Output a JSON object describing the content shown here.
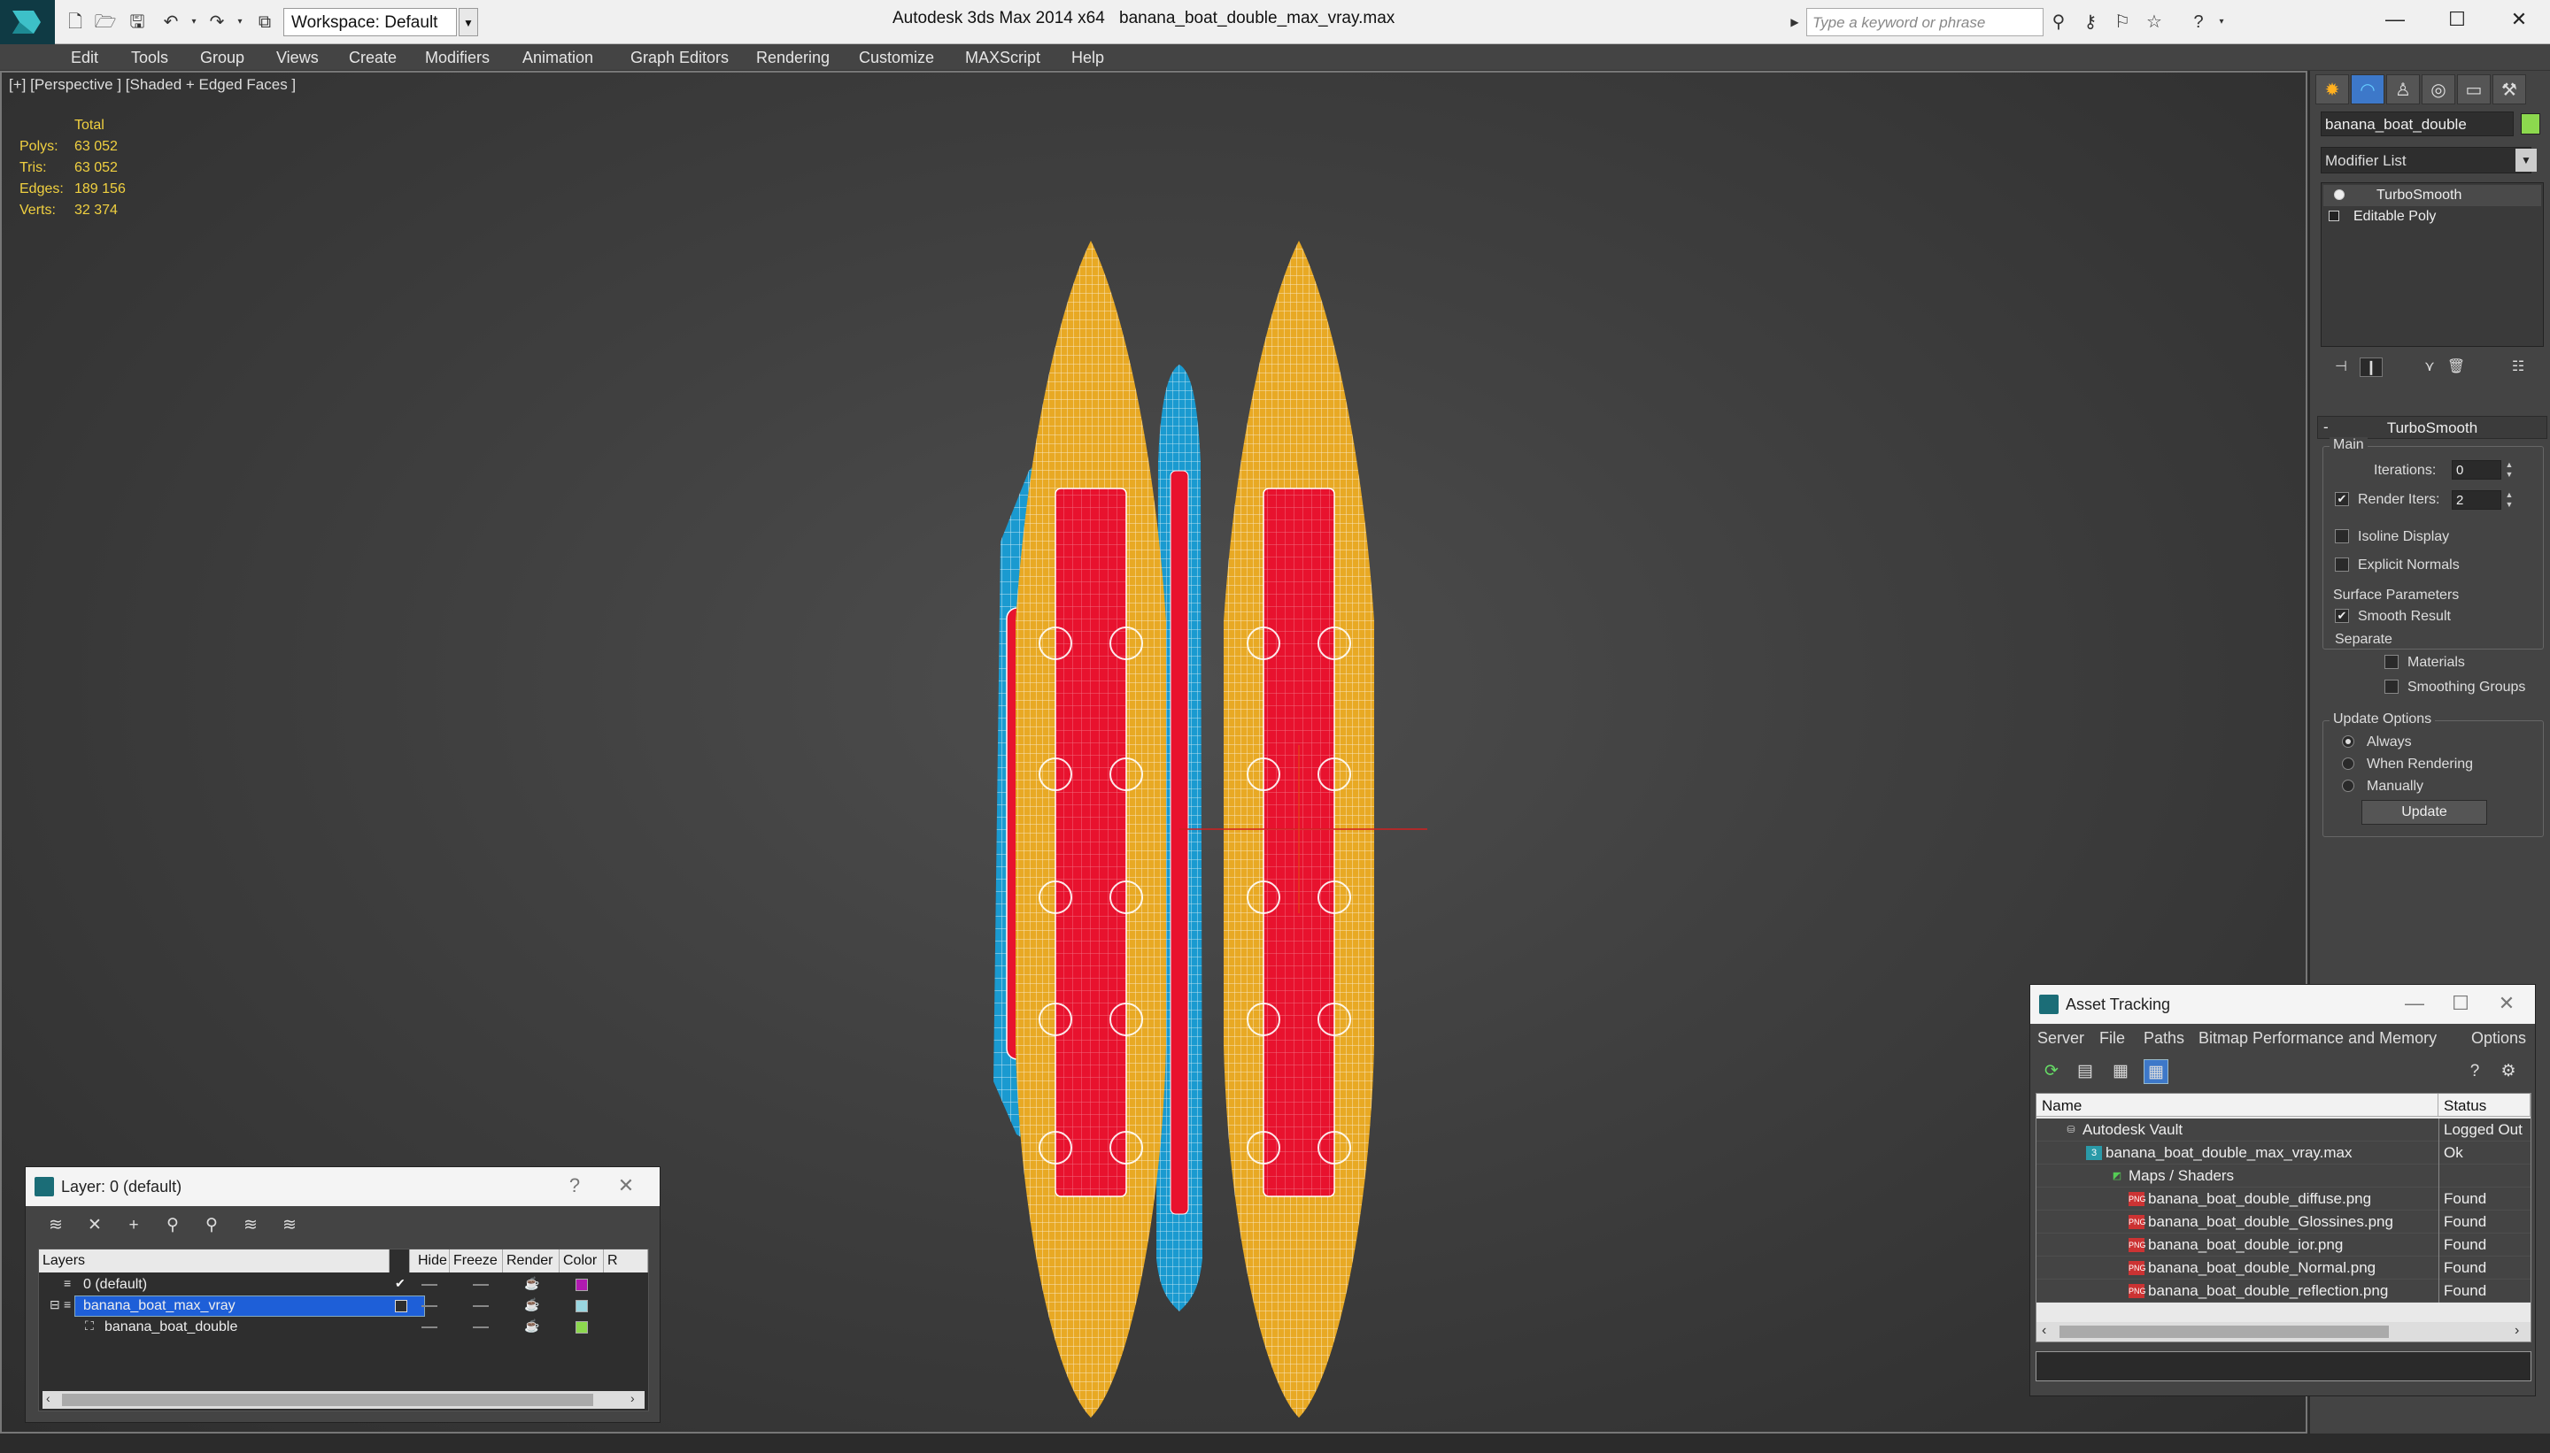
{
  "titlebar": {
    "workspace": "Workspace: Default",
    "app_title": "Autodesk 3ds Max  2014 x64",
    "file_title": "banana_boat_double_max_vray.max",
    "search_placeholder": "Type a keyword or phrase"
  },
  "menu": [
    "Edit",
    "Tools",
    "Group",
    "Views",
    "Create",
    "Modifiers",
    "Animation",
    "Graph Editors",
    "Rendering",
    "Customize",
    "MAXScript",
    "Help"
  ],
  "viewport": {
    "label": "[+] [Perspective ] [Shaded + Edged Faces ]",
    "stats_header": "Total",
    "stats": [
      {
        "label": "Polys:",
        "value": "63 052"
      },
      {
        "label": "Tris:",
        "value": "63 052"
      },
      {
        "label": "Edges:",
        "value": "189 156"
      },
      {
        "label": "Verts:",
        "value": "32 374"
      }
    ]
  },
  "command_panel": {
    "object_name": "banana_boat_double",
    "modifier_list": "Modifier List",
    "stack": [
      "TurboSmooth",
      "Editable Poly"
    ],
    "rollout_title": "TurboSmooth",
    "main_group": "Main",
    "iterations_label": "Iterations:",
    "iterations_value": "0",
    "render_iters_label": "Render Iters:",
    "render_iters_value": "2",
    "isoline_label": "Isoline Display",
    "explicit_normals_label": "Explicit Normals",
    "surface_group": "Surface Parameters",
    "smooth_result_label": "Smooth Result",
    "separate_label": "Separate",
    "materials_label": "Materials",
    "smoothing_groups_label": "Smoothing Groups",
    "update_group": "Update Options",
    "always_label": "Always",
    "when_rendering_label": "When Rendering",
    "manually_label": "Manually",
    "update_button": "Update"
  },
  "layer_window": {
    "title": "Layer: 0 (default)",
    "headers": [
      "Layers",
      "Hide",
      "Freeze",
      "Render",
      "Color",
      "R"
    ],
    "rows": [
      {
        "name": "0 (default)",
        "color": "#b01ab0"
      },
      {
        "name": "banana_boat_max_vray",
        "color": "#9ad6e0"
      },
      {
        "name": "banana_boat_double",
        "color": "#8cd84e"
      }
    ]
  },
  "asset_window": {
    "title": "Asset Tracking",
    "menu": [
      "Server",
      "File",
      "Paths",
      "Bitmap Performance and Memory",
      "Options"
    ],
    "headers": [
      "Name",
      "Status"
    ],
    "rows": [
      {
        "name": "Autodesk Vault",
        "status": "Logged Out"
      },
      {
        "name": "banana_boat_double_max_vray.max",
        "status": "Ok"
      },
      {
        "name": "Maps / Shaders",
        "status": ""
      },
      {
        "name": "banana_boat_double_diffuse.png",
        "status": "Found"
      },
      {
        "name": "banana_boat_double_Glossines.png",
        "status": "Found"
      },
      {
        "name": "banana_boat_double_ior.png",
        "status": "Found"
      },
      {
        "name": "banana_boat_double_Normal.png",
        "status": "Found"
      },
      {
        "name": "banana_boat_double_reflection.png",
        "status": "Found"
      }
    ]
  },
  "colors": {
    "tube_yellow": "#e8a924",
    "tube_blue": "#1a9ad0",
    "seat_red": "#e8122e",
    "stats_yellow": "#f0d040",
    "selection_blue": "#1e5fd8"
  }
}
